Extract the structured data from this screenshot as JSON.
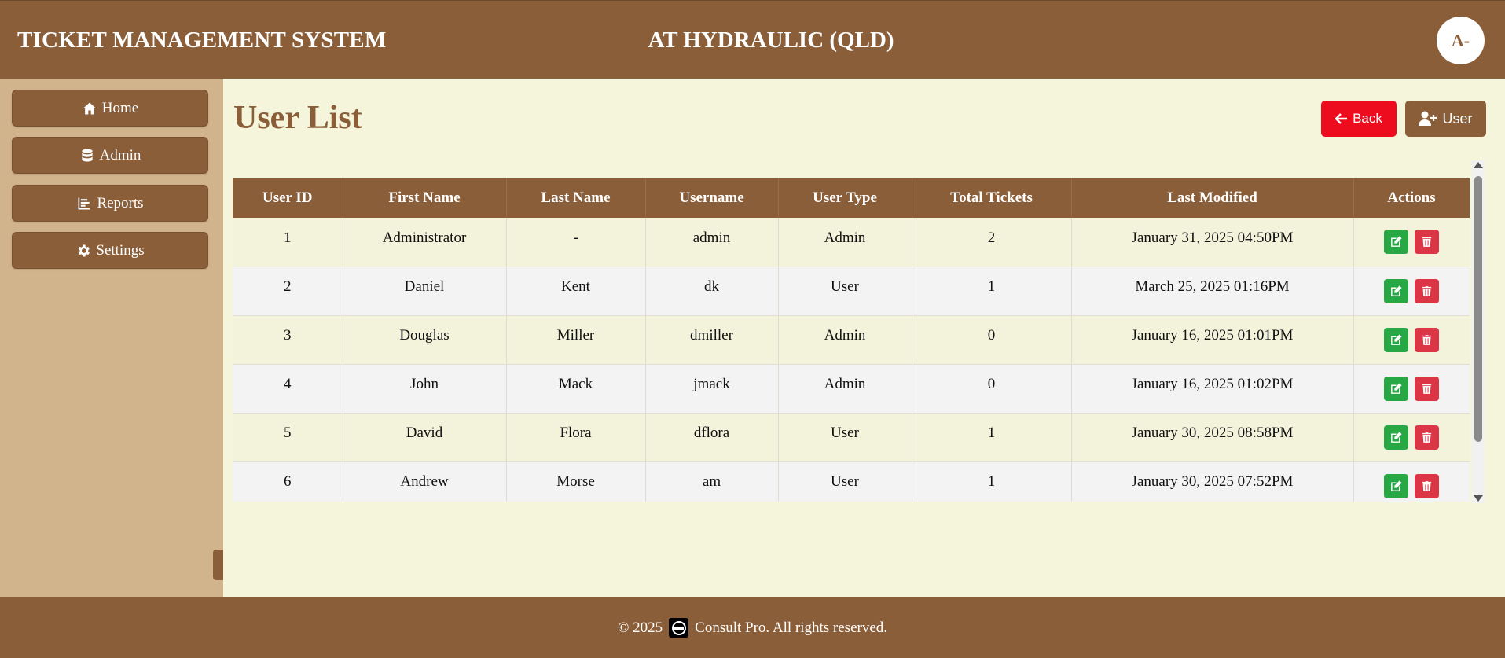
{
  "header": {
    "system_title": "TICKET MANAGEMENT SYSTEM",
    "company": "AT HYDRAULIC (QLD)",
    "avatar_initials": "A-"
  },
  "sidebar": {
    "items": [
      {
        "label": "Home",
        "icon": "home-icon"
      },
      {
        "label": "Admin",
        "icon": "database-icon"
      },
      {
        "label": "Reports",
        "icon": "chart-icon"
      },
      {
        "label": "Settings",
        "icon": "gear-icon"
      }
    ],
    "collapse_icon": "chevron-left-icon"
  },
  "main": {
    "title": "User List",
    "back_label": "Back",
    "add_user_label": "User"
  },
  "table": {
    "columns": [
      "User ID",
      "First Name",
      "Last Name",
      "Username",
      "User Type",
      "Total Tickets",
      "Last Modified",
      "Actions"
    ],
    "rows": [
      {
        "id": "1",
        "first": "Administrator",
        "last": "-",
        "username": "admin",
        "type": "Admin",
        "tickets": "2",
        "modified": "January 31, 2025 04:50PM"
      },
      {
        "id": "2",
        "first": "Daniel",
        "last": "Kent",
        "username": "dk",
        "type": "User",
        "tickets": "1",
        "modified": "March 25, 2025 01:16PM"
      },
      {
        "id": "3",
        "first": "Douglas",
        "last": "Miller",
        "username": "dmiller",
        "type": "Admin",
        "tickets": "0",
        "modified": "January 16, 2025 01:01PM"
      },
      {
        "id": "4",
        "first": "John",
        "last": "Mack",
        "username": "jmack",
        "type": "Admin",
        "tickets": "0",
        "modified": "January 16, 2025 01:02PM"
      },
      {
        "id": "5",
        "first": "David",
        "last": "Flora",
        "username": "dflora",
        "type": "User",
        "tickets": "1",
        "modified": "January 30, 2025 08:58PM"
      },
      {
        "id": "6",
        "first": "Andrew",
        "last": "Morse",
        "username": "am",
        "type": "User",
        "tickets": "1",
        "modified": "January 30, 2025 07:52PM"
      }
    ]
  },
  "footer": {
    "copyright": "© 2025",
    "company": "Consult Pro. All rights reserved."
  },
  "colors": {
    "brand": "#8b5e3a",
    "sidebar_bg": "#d2b48c",
    "page_bg": "#f5f5dc",
    "back_button": "#ec0c1e",
    "edit_button": "#28a745",
    "delete_button": "#dc3545"
  }
}
